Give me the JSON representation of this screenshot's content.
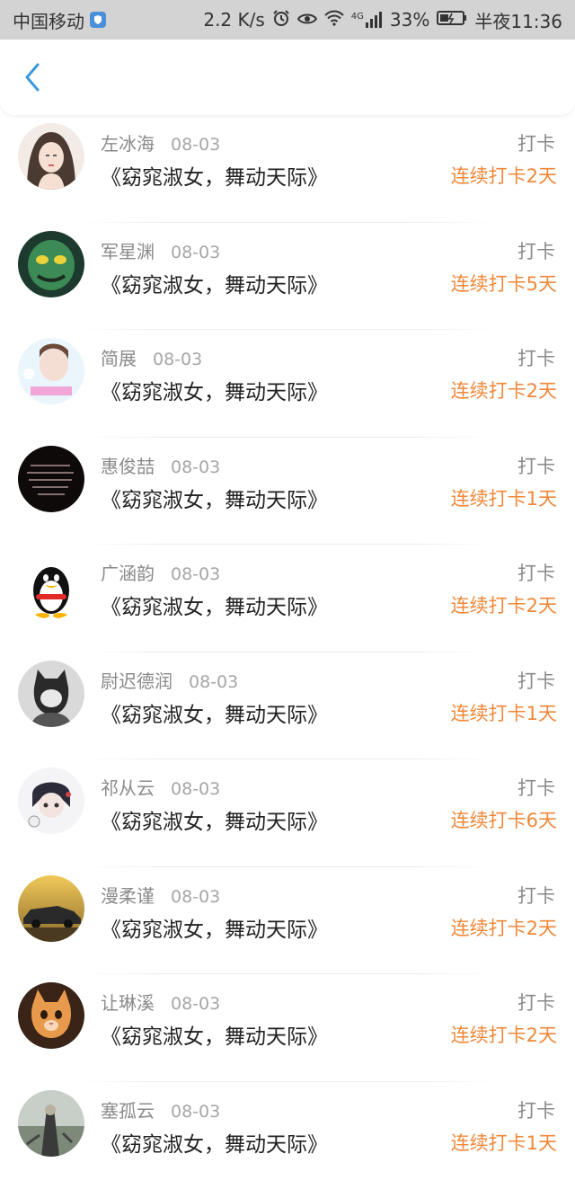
{
  "status_bar": {
    "carrier": "中国移动",
    "speed": "2.2 K/s",
    "battery": "33%",
    "time": "半夜11:36",
    "network": "4G"
  },
  "colors": {
    "streak": "#f0883a",
    "back": "#3a9ad9"
  },
  "items": [
    {
      "name": "左冰海",
      "date": "08-03",
      "title": "《窈窕淑女，舞动天际》",
      "kind": "打卡",
      "streak": "连续打卡2天"
    },
    {
      "name": "军星渊",
      "date": "08-03",
      "title": "《窈窕淑女，舞动天际》",
      "kind": "打卡",
      "streak": "连续打卡5天"
    },
    {
      "name": "简展",
      "date": "08-03",
      "title": "《窈窕淑女，舞动天际》",
      "kind": "打卡",
      "streak": "连续打卡2天"
    },
    {
      "name": "惠俊喆",
      "date": "08-03",
      "title": "《窈窕淑女，舞动天际》",
      "kind": "打卡",
      "streak": "连续打卡1天"
    },
    {
      "name": "广涵韵",
      "date": "08-03",
      "title": "《窈窕淑女，舞动天际》",
      "kind": "打卡",
      "streak": "连续打卡2天"
    },
    {
      "name": "尉迟德润",
      "date": "08-03",
      "title": "《窈窕淑女，舞动天际》",
      "kind": "打卡",
      "streak": "连续打卡1天"
    },
    {
      "name": "祁从云",
      "date": "08-03",
      "title": "《窈窕淑女，舞动天际》",
      "kind": "打卡",
      "streak": "连续打卡6天"
    },
    {
      "name": "漫柔谨",
      "date": "08-03",
      "title": "《窈窕淑女，舞动天际》",
      "kind": "打卡",
      "streak": "连续打卡2天"
    },
    {
      "name": "让琳溪",
      "date": "08-03",
      "title": "《窈窕淑女，舞动天际》",
      "kind": "打卡",
      "streak": "连续打卡2天"
    },
    {
      "name": "塞孤云",
      "date": "08-03",
      "title": "《窈窕淑女，舞动天际》",
      "kind": "打卡",
      "streak": "连续打卡1天"
    }
  ]
}
